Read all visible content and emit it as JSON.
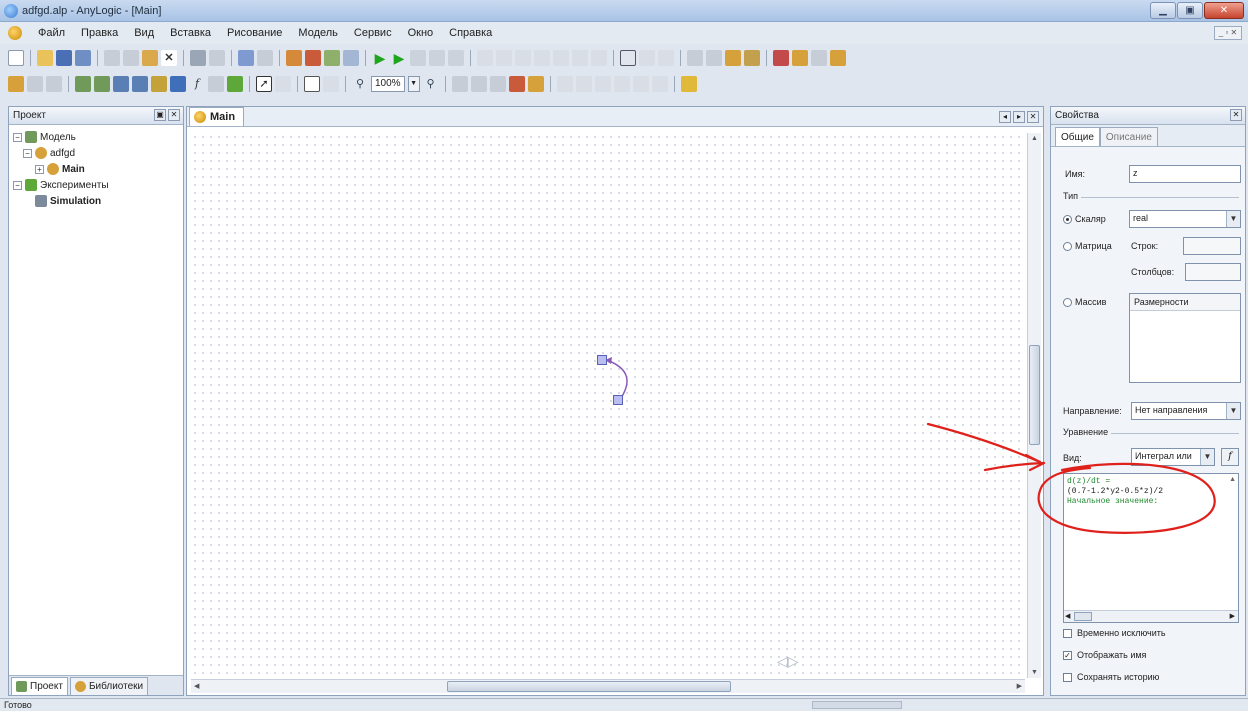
{
  "window": {
    "title": "adfgd.alp - AnyLogic - [Main]"
  },
  "menu": {
    "items": [
      "Файл",
      "Правка",
      "Вид",
      "Вставка",
      "Рисование",
      "Модель",
      "Сервис",
      "Окно",
      "Справка"
    ]
  },
  "toolbar": {
    "zoom": "100%"
  },
  "project_panel": {
    "title": "Проект",
    "tree": {
      "model": "Модель",
      "model_name": "adfgd",
      "main": "Main",
      "experiments": "Эксперименты",
      "simulation": "Simulation"
    },
    "tabs": [
      "Проект",
      "Библиотеки"
    ]
  },
  "editor": {
    "tab": "Main"
  },
  "properties": {
    "title": "Свойства",
    "tabs": [
      "Общие",
      "Описание"
    ],
    "name_label": "Имя:",
    "name_value": "z",
    "type_group": "Тип",
    "scalar_label": "Скаляр",
    "scalar_type": "real",
    "matrix_label": "Матрица",
    "rows_label": "Строк:",
    "cols_label": "Столбцов:",
    "array_label": "Массив",
    "dimensions_header": "Размерности",
    "direction_label": "Направление:",
    "direction_value": "Нет направления",
    "equation_group": "Уравнение",
    "view_label": "Вид:",
    "view_value": "Интеграл или",
    "f_button": "f",
    "equation_lines": [
      "d(z)/dt =",
      "(0.7-1.2*y2-0.5*z)/2",
      "Начальное значение:"
    ],
    "check_disable": "Временно исключить",
    "check_show_name": "Отображать имя",
    "check_history": "Сохранять историю"
  },
  "status": {
    "text": "Готово"
  },
  "colors": {
    "title_gradient": "#a9c3e6",
    "annotation": "#e0201b",
    "equation_green": "#1e8a2e",
    "variable_fill": "#b9bdf0",
    "connector": "#8a5ab8"
  }
}
